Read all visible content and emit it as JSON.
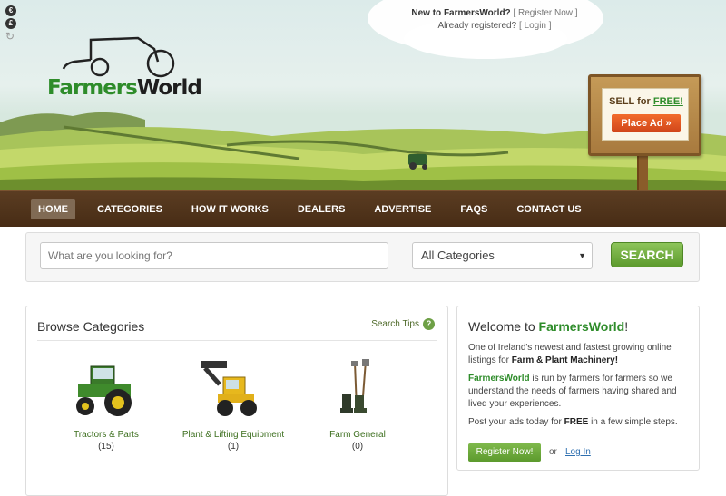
{
  "header": {
    "new_text": "New to FarmersWorld?",
    "register_link": "[ Register Now ]",
    "already_text": "Already registered?",
    "login_link": "[ Login ]",
    "currencies": [
      "€",
      "£"
    ],
    "logo_part1": "Farmers",
    "logo_part2": "World",
    "sell_prefix": "SELL for ",
    "sell_free": "FREE!",
    "place_ad": "Place Ad »"
  },
  "nav": {
    "items": [
      "HOME",
      "CATEGORIES",
      "HOW IT WORKS",
      "DEALERS",
      "ADVERTISE",
      "FAQS",
      "CONTACT US"
    ],
    "active": "HOME"
  },
  "search": {
    "placeholder": "What are you looking for?",
    "category_selected": "All Categories",
    "button": "SEARCH"
  },
  "browse": {
    "title": "Browse Categories",
    "tips": "Search Tips",
    "categories": [
      {
        "name": "Tractors & Parts",
        "count": "(15)",
        "icon": "tractor-icon"
      },
      {
        "name": "Plant & Lifting Equipment",
        "count": "(1)",
        "icon": "digger-icon"
      },
      {
        "name": "Farm General",
        "count": "(0)",
        "icon": "farm-tools-icon"
      }
    ]
  },
  "welcome": {
    "title_prefix": "Welcome to ",
    "title_brand": "FarmersWorld",
    "title_suffix": "!",
    "para1": "One of Ireland's newest and fastest growing online listings for ",
    "para1_bold": "Farm & Plant Machinery!",
    "para2_brand": "FarmersWorld",
    "para2": " is run by farmers for farmers so we understand the needs of farmers having shared and lived your experiences.",
    "para3": "Post your ads today for ",
    "para3_bold": "FREE",
    "para3_end": " in a few simple steps.",
    "register_btn": "Register Now!",
    "or": "or",
    "login": "Log In"
  },
  "colors": {
    "brand_green": "#2e8c2a",
    "nav_brown": "#5b3d22",
    "button_green": "#6ea046",
    "place_ad_orange": "#e85a22"
  }
}
